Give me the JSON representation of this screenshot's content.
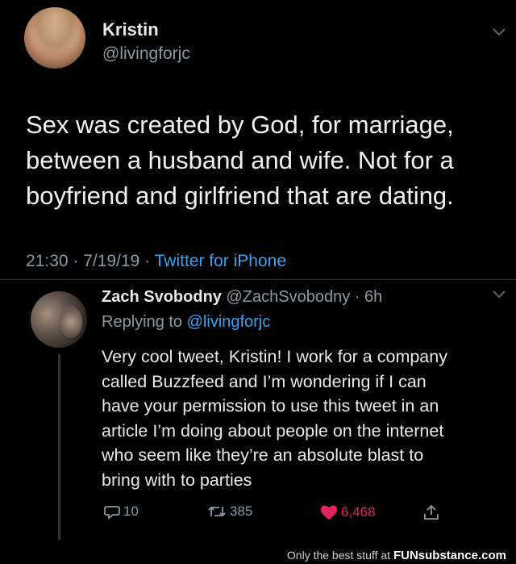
{
  "tweet": {
    "author_name": "Kristin",
    "author_handle": "@livingforjc",
    "text_lines": [
      "Sex was created by God, for marriage,",
      "between a husband and wife. Not for a",
      "boyfriend and girlfriend that are dating."
    ],
    "time": "21:30",
    "date": "7/19/19",
    "source": "Twitter for iPhone"
  },
  "reply": {
    "author_name": "Zach Svobodny",
    "author_handle": "@ZachSvobodny",
    "age": "6h",
    "replying_label": "Replying to",
    "replying_to": "@livingforjc",
    "text_lines": [
      "Very cool tweet, Kristin! I work for a company",
      "called Buzzfeed and I’m wondering if I can",
      "have your permission to use this tweet in an",
      "article I’m doing about people on the internet",
      "who seem like they’re an absolute blast to",
      "bring with to parties"
    ],
    "replies": "10",
    "retweets": "385",
    "likes": "6,468"
  },
  "footer": {
    "prefix": "Only the best stuff at",
    "brand": "FUNsubstance.com"
  },
  "colors": {
    "background": "#000000",
    "link": "#36a3f2",
    "like": "#e0245e",
    "muted": "#8b98a5"
  },
  "icons": [
    "chevron-down-icon",
    "reply-icon",
    "retweet-icon",
    "heart-icon",
    "share-icon"
  ]
}
